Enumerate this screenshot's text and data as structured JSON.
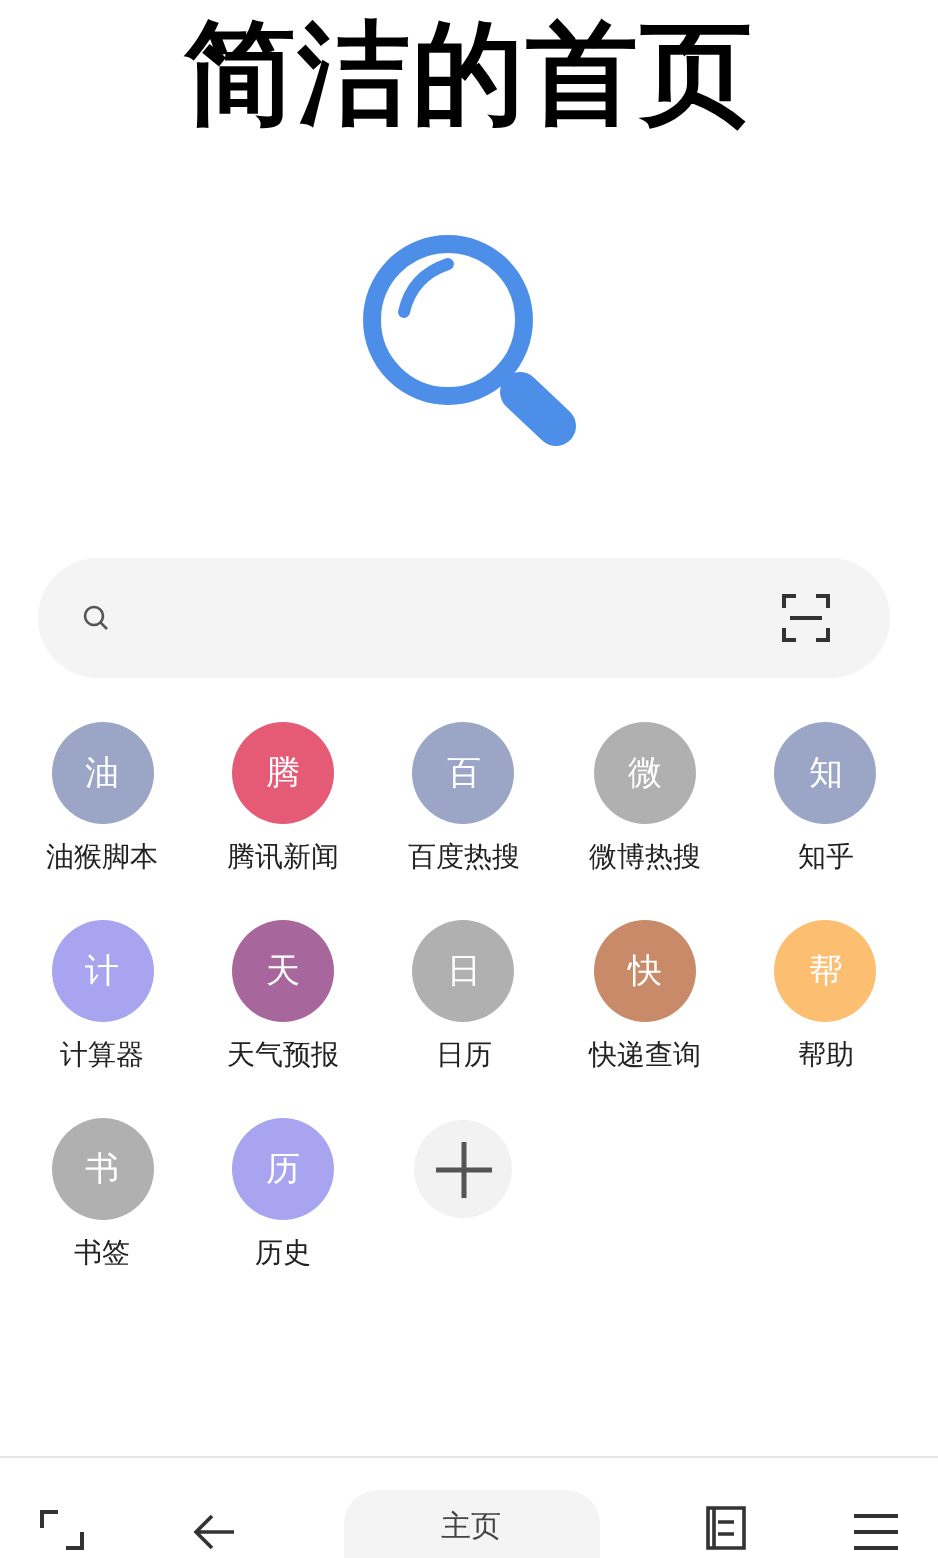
{
  "title": "简洁的首页",
  "shortcuts": [
    {
      "glyph": "油",
      "label": "油猴脚本",
      "color": "#9ba6c6"
    },
    {
      "glyph": "腾",
      "label": "腾讯新闻",
      "color": "#e55a75"
    },
    {
      "glyph": "百",
      "label": "百度热搜",
      "color": "#9ba6c6"
    },
    {
      "glyph": "微",
      "label": "微博热搜",
      "color": "#b0b0b0"
    },
    {
      "glyph": "知",
      "label": "知乎",
      "color": "#9ba6c6"
    },
    {
      "glyph": "计",
      "label": "计算器",
      "color": "#a8a4f0"
    },
    {
      "glyph": "天",
      "label": "天气预报",
      "color": "#a8679c"
    },
    {
      "glyph": "日",
      "label": "日历",
      "color": "#b0b0b0"
    },
    {
      "glyph": "快",
      "label": "快递查询",
      "color": "#c88a68"
    },
    {
      "glyph": "帮",
      "label": "帮助",
      "color": "#fcbe70"
    },
    {
      "glyph": "书",
      "label": "书签",
      "color": "#b0b0b0"
    },
    {
      "glyph": "历",
      "label": "历史",
      "color": "#a8a4f0"
    }
  ],
  "bottom_nav": {
    "home_label": "主页"
  }
}
